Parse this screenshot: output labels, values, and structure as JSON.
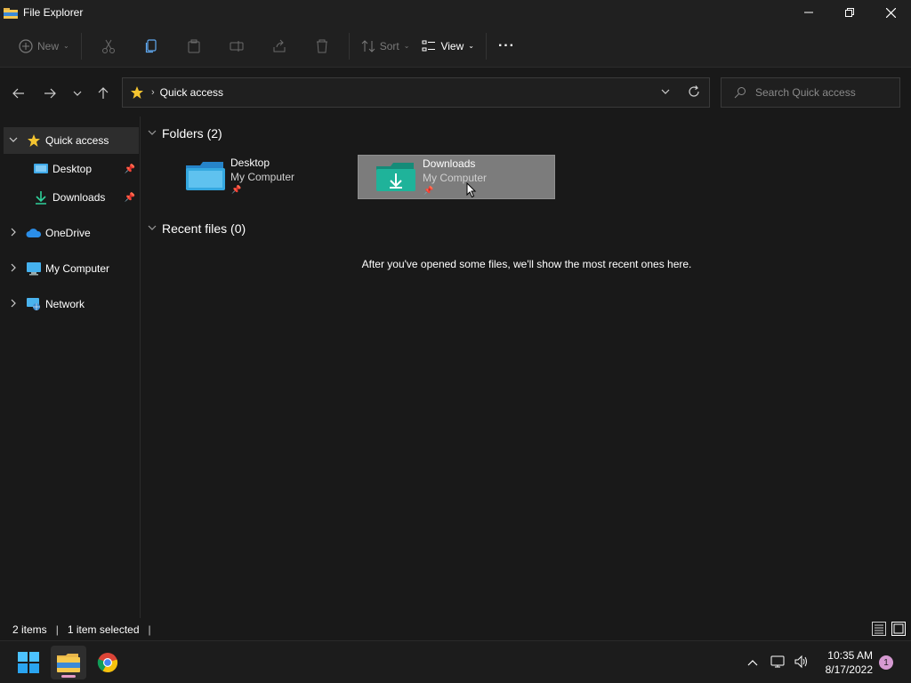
{
  "window": {
    "title": "File Explorer"
  },
  "toolbar": {
    "new_label": "New",
    "sort_label": "Sort",
    "view_label": "View",
    "more_label": "···"
  },
  "address": {
    "crumb": "Quick access",
    "search_placeholder": "Search Quick access"
  },
  "sidebar": {
    "items": [
      {
        "label": "Quick access",
        "icon": "star-icon",
        "expanded": true,
        "selected": true
      },
      {
        "label": "Desktop",
        "icon": "desktop-icon",
        "pinned": true
      },
      {
        "label": "Downloads",
        "icon": "download-icon",
        "pinned": true
      },
      {
        "label": "OneDrive",
        "icon": "cloud-icon"
      },
      {
        "label": "My Computer",
        "icon": "computer-icon"
      },
      {
        "label": "Network",
        "icon": "network-icon"
      }
    ]
  },
  "content": {
    "folders_header": "Folders (2)",
    "folders": [
      {
        "name": "Desktop",
        "location": "My Computer",
        "pinned": true,
        "selected": false
      },
      {
        "name": "Downloads",
        "location": "My Computer",
        "pinned": true,
        "selected": true
      }
    ],
    "recent_header": "Recent files (0)",
    "recent_empty": "After you've opened some files, we'll show the most recent ones here."
  },
  "status": {
    "items_count": "2 items",
    "selection": "1 item selected"
  },
  "taskbar": {
    "time": "10:35 AM",
    "date": "8/17/2022",
    "notification_count": "1"
  },
  "colors": {
    "accent_folder": "#34a8e0",
    "accent_downloads": "#1fb39a",
    "star": "#f4c430",
    "selection": "#7c7c7c"
  }
}
